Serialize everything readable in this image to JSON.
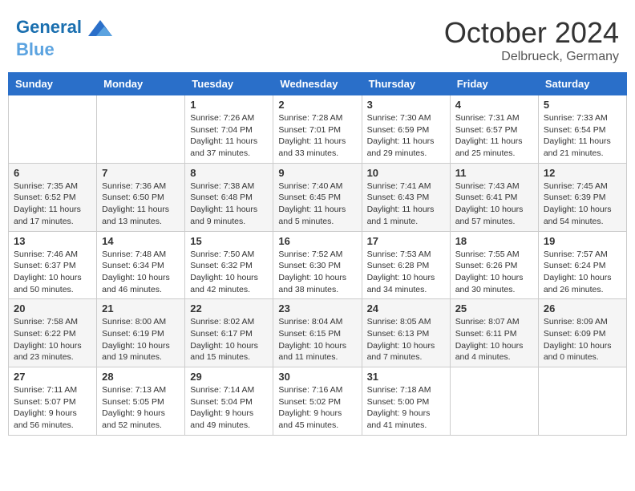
{
  "header": {
    "logo_line1": "General",
    "logo_line2": "Blue",
    "month": "October 2024",
    "location": "Delbrueck, Germany"
  },
  "days_of_week": [
    "Sunday",
    "Monday",
    "Tuesday",
    "Wednesday",
    "Thursday",
    "Friday",
    "Saturday"
  ],
  "weeks": [
    [
      {
        "day": "",
        "content": ""
      },
      {
        "day": "",
        "content": ""
      },
      {
        "day": "1",
        "content": "Sunrise: 7:26 AM\nSunset: 7:04 PM\nDaylight: 11 hours and 37 minutes."
      },
      {
        "day": "2",
        "content": "Sunrise: 7:28 AM\nSunset: 7:01 PM\nDaylight: 11 hours and 33 minutes."
      },
      {
        "day": "3",
        "content": "Sunrise: 7:30 AM\nSunset: 6:59 PM\nDaylight: 11 hours and 29 minutes."
      },
      {
        "day": "4",
        "content": "Sunrise: 7:31 AM\nSunset: 6:57 PM\nDaylight: 11 hours and 25 minutes."
      },
      {
        "day": "5",
        "content": "Sunrise: 7:33 AM\nSunset: 6:54 PM\nDaylight: 11 hours and 21 minutes."
      }
    ],
    [
      {
        "day": "6",
        "content": "Sunrise: 7:35 AM\nSunset: 6:52 PM\nDaylight: 11 hours and 17 minutes."
      },
      {
        "day": "7",
        "content": "Sunrise: 7:36 AM\nSunset: 6:50 PM\nDaylight: 11 hours and 13 minutes."
      },
      {
        "day": "8",
        "content": "Sunrise: 7:38 AM\nSunset: 6:48 PM\nDaylight: 11 hours and 9 minutes."
      },
      {
        "day": "9",
        "content": "Sunrise: 7:40 AM\nSunset: 6:45 PM\nDaylight: 11 hours and 5 minutes."
      },
      {
        "day": "10",
        "content": "Sunrise: 7:41 AM\nSunset: 6:43 PM\nDaylight: 11 hours and 1 minute."
      },
      {
        "day": "11",
        "content": "Sunrise: 7:43 AM\nSunset: 6:41 PM\nDaylight: 10 hours and 57 minutes."
      },
      {
        "day": "12",
        "content": "Sunrise: 7:45 AM\nSunset: 6:39 PM\nDaylight: 10 hours and 54 minutes."
      }
    ],
    [
      {
        "day": "13",
        "content": "Sunrise: 7:46 AM\nSunset: 6:37 PM\nDaylight: 10 hours and 50 minutes."
      },
      {
        "day": "14",
        "content": "Sunrise: 7:48 AM\nSunset: 6:34 PM\nDaylight: 10 hours and 46 minutes."
      },
      {
        "day": "15",
        "content": "Sunrise: 7:50 AM\nSunset: 6:32 PM\nDaylight: 10 hours and 42 minutes."
      },
      {
        "day": "16",
        "content": "Sunrise: 7:52 AM\nSunset: 6:30 PM\nDaylight: 10 hours and 38 minutes."
      },
      {
        "day": "17",
        "content": "Sunrise: 7:53 AM\nSunset: 6:28 PM\nDaylight: 10 hours and 34 minutes."
      },
      {
        "day": "18",
        "content": "Sunrise: 7:55 AM\nSunset: 6:26 PM\nDaylight: 10 hours and 30 minutes."
      },
      {
        "day": "19",
        "content": "Sunrise: 7:57 AM\nSunset: 6:24 PM\nDaylight: 10 hours and 26 minutes."
      }
    ],
    [
      {
        "day": "20",
        "content": "Sunrise: 7:58 AM\nSunset: 6:22 PM\nDaylight: 10 hours and 23 minutes."
      },
      {
        "day": "21",
        "content": "Sunrise: 8:00 AM\nSunset: 6:19 PM\nDaylight: 10 hours and 19 minutes."
      },
      {
        "day": "22",
        "content": "Sunrise: 8:02 AM\nSunset: 6:17 PM\nDaylight: 10 hours and 15 minutes."
      },
      {
        "day": "23",
        "content": "Sunrise: 8:04 AM\nSunset: 6:15 PM\nDaylight: 10 hours and 11 minutes."
      },
      {
        "day": "24",
        "content": "Sunrise: 8:05 AM\nSunset: 6:13 PM\nDaylight: 10 hours and 7 minutes."
      },
      {
        "day": "25",
        "content": "Sunrise: 8:07 AM\nSunset: 6:11 PM\nDaylight: 10 hours and 4 minutes."
      },
      {
        "day": "26",
        "content": "Sunrise: 8:09 AM\nSunset: 6:09 PM\nDaylight: 10 hours and 0 minutes."
      }
    ],
    [
      {
        "day": "27",
        "content": "Sunrise: 7:11 AM\nSunset: 5:07 PM\nDaylight: 9 hours and 56 minutes."
      },
      {
        "day": "28",
        "content": "Sunrise: 7:13 AM\nSunset: 5:05 PM\nDaylight: 9 hours and 52 minutes."
      },
      {
        "day": "29",
        "content": "Sunrise: 7:14 AM\nSunset: 5:04 PM\nDaylight: 9 hours and 49 minutes."
      },
      {
        "day": "30",
        "content": "Sunrise: 7:16 AM\nSunset: 5:02 PM\nDaylight: 9 hours and 45 minutes."
      },
      {
        "day": "31",
        "content": "Sunrise: 7:18 AM\nSunset: 5:00 PM\nDaylight: 9 hours and 41 minutes."
      },
      {
        "day": "",
        "content": ""
      },
      {
        "day": "",
        "content": ""
      }
    ]
  ]
}
